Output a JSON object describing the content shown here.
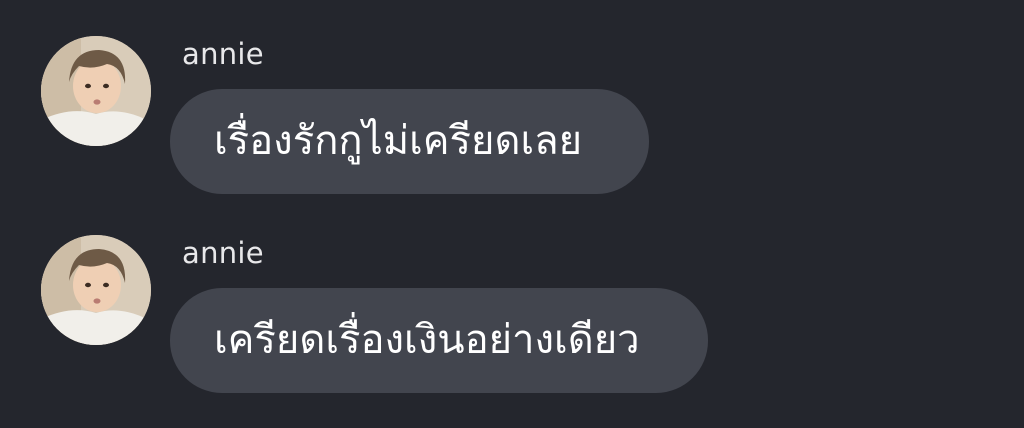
{
  "messages": [
    {
      "sender": "annie",
      "avatar_icon": "user-photo-avatar",
      "text": "เรื่องรักกูไม่เครียดเลย"
    },
    {
      "sender": "annie",
      "avatar_icon": "user-photo-avatar",
      "text": "เครียดเรื่องเงินอย่างเดียว"
    }
  ],
  "colors": {
    "background": "#24262d",
    "bubble": "#42454e",
    "sender_text": "#e8e8ea",
    "message_text": "#ffffff"
  }
}
